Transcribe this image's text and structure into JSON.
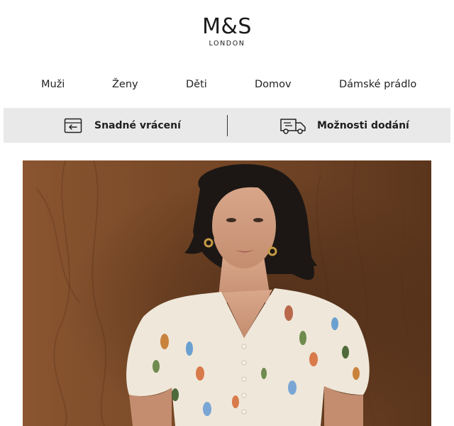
{
  "brand": {
    "name": "M&S",
    "subtitle": "LONDON"
  },
  "nav": {
    "items": [
      {
        "label": "Muži"
      },
      {
        "label": "Ženy"
      },
      {
        "label": "Děti"
      },
      {
        "label": "Domov"
      },
      {
        "label": "Dámské prádlo"
      }
    ]
  },
  "service_bar": {
    "returns_label": "Snadné vrácení",
    "returns_icon": "return-parcel-icon",
    "delivery_label": "Možnosti dodání",
    "delivery_icon": "delivery-truck-icon"
  },
  "hero": {
    "image": "woman-in-floral-blouse-photo",
    "colors": {
      "wood": "#7a4a28",
      "blouse": "#efe7da",
      "hair": "#1c1714"
    }
  }
}
